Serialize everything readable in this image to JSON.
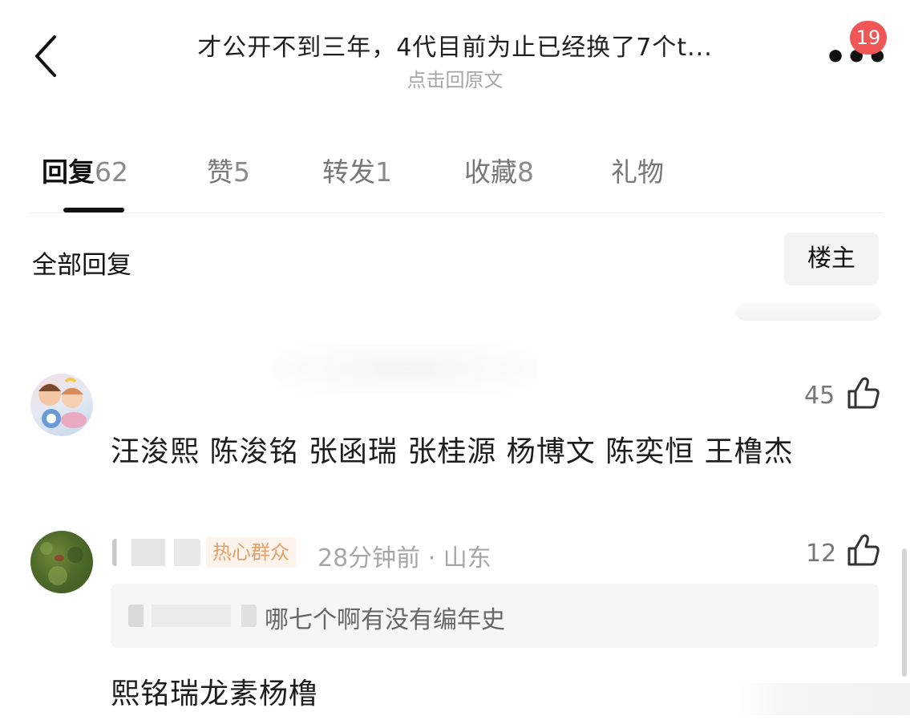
{
  "header": {
    "title": "才公开不到三年，4代目前为止已经换了7个t...",
    "subtitle": "点击回原文",
    "notification_count": "19",
    "more_icon": "more-dots-icon",
    "back_icon": "chevron-left-icon"
  },
  "tabs": [
    {
      "label": "回复",
      "count": "62",
      "active": true
    },
    {
      "label": "赞",
      "count": "5"
    },
    {
      "label": "转发",
      "count": "1"
    },
    {
      "label": "收藏",
      "count": "8"
    },
    {
      "label": "礼物",
      "count": ""
    }
  ],
  "filter": {
    "all_replies": "全部回复",
    "op_only": "楼主"
  },
  "comments": [
    {
      "like_count": "45",
      "text": "汪浚熙 陈浚铭 张函瑞 张桂源 杨博文 陈奕恒 王橹杰"
    },
    {
      "badge": "热心群众",
      "meta": "28分钟前 · 山东",
      "like_count": "12",
      "quote_text": "哪七个啊有没有编年史",
      "text": "熙铭瑞龙素杨橹"
    }
  ],
  "colors": {
    "badge_red": "#f05656",
    "badge_bg": "#fdf3ea",
    "badge_text": "#e2a06b",
    "quote_bg": "#f6f6f6"
  }
}
